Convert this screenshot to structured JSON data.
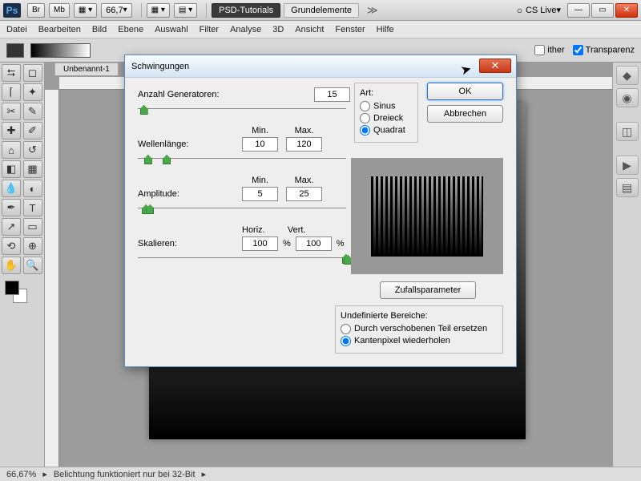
{
  "titlebar": {
    "ps": "Ps",
    "br": "Br",
    "mb": "Mb",
    "zoom": "66,7",
    "tab_dark": "PSD-Tutorials",
    "tab_light": "Grundelemente",
    "cslive": "CS Live"
  },
  "menu": [
    "Datei",
    "Bearbeiten",
    "Bild",
    "Ebene",
    "Auswahl",
    "Filter",
    "Analyse",
    "3D",
    "Ansicht",
    "Fenster",
    "Hilfe"
  ],
  "optionbar": {
    "dither_label": "ither",
    "transparency_label": "Transparenz",
    "dither_checked": false,
    "transparency_checked": true
  },
  "doc_tab": "Unbenannt-1",
  "status": {
    "zoom": "66,67%",
    "msg": "Belichtung funktioniert nur bei 32-Bit"
  },
  "dialog": {
    "title": "Schwingungen",
    "generators_label": "Anzahl Generatoren:",
    "generators_value": "15",
    "min_label": "Min.",
    "max_label": "Max.",
    "wavelength_label": "Wellenlänge:",
    "wavelength_min": "10",
    "wavelength_max": "120",
    "amplitude_label": "Amplitude:",
    "amplitude_min": "5",
    "amplitude_max": "25",
    "horiz_label": "Horiz.",
    "vert_label": "Vert.",
    "scale_label": "Skalieren:",
    "scale_h": "100",
    "scale_v": "100",
    "percent": "%",
    "art_title": "Art:",
    "art_sinus": "Sinus",
    "art_dreieck": "Dreieck",
    "art_quadrat": "Quadrat",
    "ok": "OK",
    "cancel": "Abbrechen",
    "random": "Zufallsparameter",
    "undef_title": "Undefinierte Bereiche:",
    "undef_opt1": "Durch verschobenen Teil ersetzen",
    "undef_opt2": "Kantenpixel wiederholen"
  }
}
